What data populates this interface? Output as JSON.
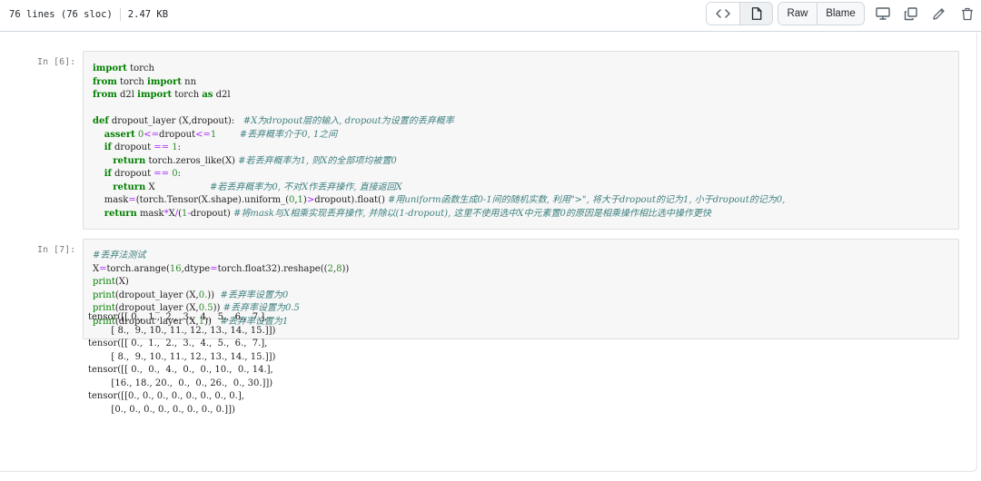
{
  "file_header": {
    "lines_info": "76 lines (76 sloc)",
    "size": "2.47 KB",
    "raw_label": "Raw",
    "blame_label": "Blame"
  },
  "cells": [
    {
      "prompt": "In [6]:",
      "lines": [
        [
          {
            "t": "import",
            "c": "kw"
          },
          {
            "t": " torch"
          }
        ],
        [
          {
            "t": "from",
            "c": "kw"
          },
          {
            "t": " torch "
          },
          {
            "t": "import",
            "c": "kw"
          },
          {
            "t": " nn"
          }
        ],
        [
          {
            "t": "from",
            "c": "kw"
          },
          {
            "t": " d2l "
          },
          {
            "t": "import",
            "c": "kw"
          },
          {
            "t": " torch "
          },
          {
            "t": "as",
            "c": "kw"
          },
          {
            "t": " d2l"
          }
        ],
        [],
        [
          {
            "t": "def",
            "c": "kw"
          },
          {
            "t": " dropout_layer (X,dropout):   "
          },
          {
            "t": "#X为dropout层的输入, dropout为设置的丢弃概率",
            "c": "cm"
          }
        ],
        [
          {
            "t": "    "
          },
          {
            "t": "assert",
            "c": "kw"
          },
          {
            "t": " "
          },
          {
            "t": "0",
            "c": "num"
          },
          {
            "t": "<=",
            "c": "op"
          },
          {
            "t": "dropout"
          },
          {
            "t": "<=",
            "c": "op"
          },
          {
            "t": "1",
            "c": "num"
          },
          {
            "t": "        "
          },
          {
            "t": "#丢弃概率介于0, 1之间",
            "c": "cm"
          }
        ],
        [
          {
            "t": "    "
          },
          {
            "t": "if",
            "c": "kw"
          },
          {
            "t": " dropout "
          },
          {
            "t": "==",
            "c": "op"
          },
          {
            "t": " "
          },
          {
            "t": "1",
            "c": "num"
          },
          {
            "t": ":"
          }
        ],
        [
          {
            "t": "       "
          },
          {
            "t": "return",
            "c": "kw"
          },
          {
            "t": " torch.zeros_like(X) "
          },
          {
            "t": "#若丢弃概率为1, 则X的全部项均被置0",
            "c": "cm"
          }
        ],
        [
          {
            "t": "    "
          },
          {
            "t": "if",
            "c": "kw"
          },
          {
            "t": " dropout "
          },
          {
            "t": "==",
            "c": "op"
          },
          {
            "t": " "
          },
          {
            "t": "0",
            "c": "num"
          },
          {
            "t": ":"
          }
        ],
        [
          {
            "t": "       "
          },
          {
            "t": "return",
            "c": "kw"
          },
          {
            "t": " X                   "
          },
          {
            "t": "#若丢弃概率为0, 不对X作丢弃操作, 直接返回X",
            "c": "cm"
          }
        ],
        [
          {
            "t": "    mask"
          },
          {
            "t": "=",
            "c": "op"
          },
          {
            "t": "(torch.Tensor(X.shape).uniform_("
          },
          {
            "t": "0",
            "c": "num"
          },
          {
            "t": ","
          },
          {
            "t": "1",
            "c": "num"
          },
          {
            "t": ")"
          },
          {
            "t": ">",
            "c": "op"
          },
          {
            "t": "dropout).float() "
          },
          {
            "t": "#用uniform函数生成0-1间的随机实数, 利用\">\", 将大于dropout的记为1, 小于dropout的记为0,",
            "c": "cm"
          }
        ],
        [
          {
            "t": "    "
          },
          {
            "t": "return",
            "c": "kw"
          },
          {
            "t": " mask"
          },
          {
            "t": "*",
            "c": "op"
          },
          {
            "t": "X"
          },
          {
            "t": "/",
            "c": "op"
          },
          {
            "t": "("
          },
          {
            "t": "1",
            "c": "num"
          },
          {
            "t": "-",
            "c": "op"
          },
          {
            "t": "dropout) "
          },
          {
            "t": "#将mask与X相乘实现丢弃操作, 并除以(1-dropout), 这里不使用选中X中元素置0的原因是相乘操作相比选中操作更快",
            "c": "cm"
          }
        ]
      ]
    },
    {
      "prompt": "In [7]:",
      "lines": [
        [
          {
            "t": "#丢弃法测试",
            "c": "cm"
          }
        ],
        [
          {
            "t": "X"
          },
          {
            "t": "=",
            "c": "op"
          },
          {
            "t": "torch.arange("
          },
          {
            "t": "16",
            "c": "num"
          },
          {
            "t": ",dtype"
          },
          {
            "t": "=",
            "c": "op"
          },
          {
            "t": "torch.float32).reshape(("
          },
          {
            "t": "2",
            "c": "num"
          },
          {
            "t": ","
          },
          {
            "t": "8",
            "c": "num"
          },
          {
            "t": "))"
          }
        ],
        [
          {
            "t": "print",
            "c": "bi"
          },
          {
            "t": "(X)"
          }
        ],
        [
          {
            "t": "print",
            "c": "bi"
          },
          {
            "t": "(dropout_layer (X,"
          },
          {
            "t": "0.",
            "c": "num"
          },
          {
            "t": "))  "
          },
          {
            "t": "#丢弃率设置为0",
            "c": "cm"
          }
        ],
        [
          {
            "t": "print",
            "c": "bi"
          },
          {
            "t": "(dropout_layer (X,"
          },
          {
            "t": "0.5",
            "c": "num"
          },
          {
            "t": ")) "
          },
          {
            "t": "#丢弃率设置为0.5",
            "c": "cm"
          }
        ],
        [
          {
            "t": "print",
            "c": "bi"
          },
          {
            "t": "(dropout_layer (X,"
          },
          {
            "t": "1",
            "c": "num"
          },
          {
            "t": "))   "
          },
          {
            "t": "#丢弃率设置为1",
            "c": "cm"
          }
        ]
      ]
    }
  ],
  "output_lines": [
    "tensor([[ 0.,  1.,  2.,  3.,  4.,  5.,  6.,  7.],",
    "        [ 8.,  9., 10., 11., 12., 13., 14., 15.]])",
    "tensor([[ 0.,  1.,  2.,  3.,  4.,  5.,  6.,  7.],",
    "        [ 8.,  9., 10., 11., 12., 13., 14., 15.]])",
    "tensor([[ 0.,  0.,  4.,  0.,  0., 10.,  0., 14.],",
    "        [16., 18., 20.,  0.,  0., 26.,  0., 30.]])",
    "tensor([[0., 0., 0., 0., 0., 0., 0., 0.],",
    "        [0., 0., 0., 0., 0., 0., 0., 0.]])"
  ]
}
